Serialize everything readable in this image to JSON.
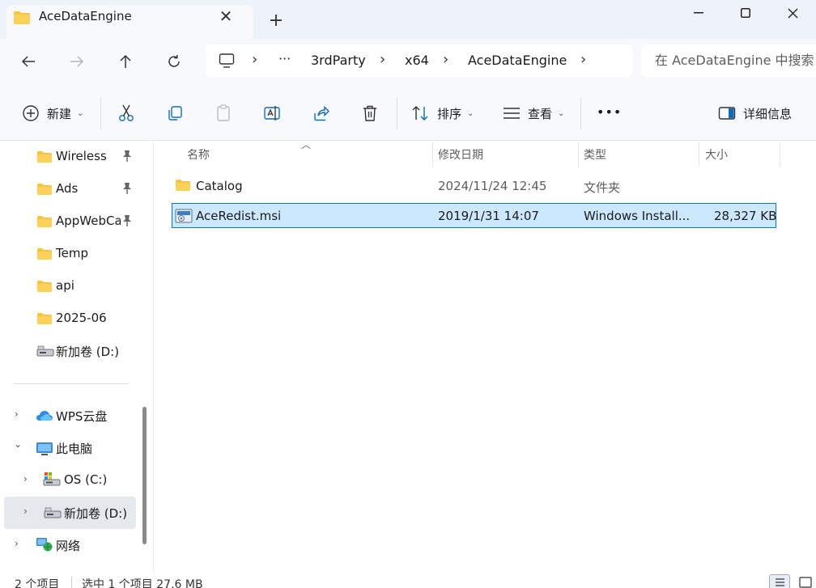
{
  "window": {
    "tab_title": "AceDataEngine",
    "tab_close_glyph": "✕",
    "new_tab_glyph": "+"
  },
  "address": {
    "breadcrumbs": [
      "3rdParty",
      "x64",
      "AceDataEngine"
    ],
    "overflow_glyph": "···",
    "search_placeholder": "在 AceDataEngine 中搜索"
  },
  "toolbar": {
    "new_label": "新建",
    "sort_label": "排序",
    "view_label": "查看",
    "more_glyph": "•••",
    "details_label": "详细信息"
  },
  "sidebar": {
    "items": [
      {
        "label": "Wireless",
        "icon": "folder-icon",
        "pinned": true
      },
      {
        "label": "Ads",
        "icon": "folder-icon",
        "pinned": true
      },
      {
        "label": "AppWebCa",
        "icon": "folder-icon",
        "pinned": true
      },
      {
        "label": "Temp",
        "icon": "folder-icon",
        "pinned": false
      },
      {
        "label": "api",
        "icon": "folder-icon",
        "pinned": false
      },
      {
        "label": "2025-06",
        "icon": "folder-icon",
        "pinned": false
      },
      {
        "label": "新加卷 (D:)",
        "icon": "drive-icon",
        "pinned": false
      }
    ],
    "tree": [
      {
        "label": "WPS云盘",
        "icon": "cloud-icon",
        "expander": "›"
      },
      {
        "label": "此电脑",
        "icon": "computer-icon",
        "expander": "⌄"
      },
      {
        "label": "OS (C:)",
        "icon": "drive-icon",
        "expander": "›"
      },
      {
        "label": "新加卷 (D:)",
        "icon": "drive-icon",
        "expander": "›",
        "selected": true
      },
      {
        "label": "网络",
        "icon": "network-icon",
        "expander": "›"
      }
    ]
  },
  "list": {
    "columns": [
      "名称",
      "修改日期",
      "类型",
      "大小"
    ],
    "rows": [
      {
        "name": "Catalog",
        "modified": "2024/11/24 12:45",
        "type": "文件夹",
        "size": "",
        "icon": "folder-icon",
        "selected": false
      },
      {
        "name": "AceRedist.msi",
        "modified": "2019/1/31 14:07",
        "type": "Windows Install...",
        "size": "28,327 KB",
        "icon": "msi-installer-icon",
        "selected": true
      }
    ]
  },
  "status": {
    "item_count": "2 个项目",
    "selection": "选中 1 个项目  27.6 MB"
  },
  "colors": {
    "selection_bg": "#cce8ff",
    "selection_border": "#0078d4",
    "folder": "#f8c33d"
  }
}
